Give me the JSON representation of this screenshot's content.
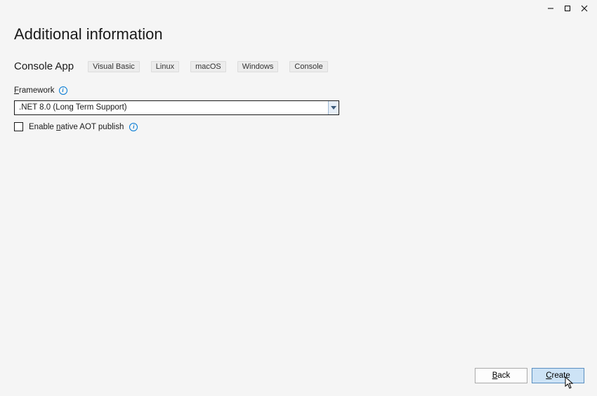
{
  "titlebar": {
    "minimize": "minimize",
    "maximize": "maximize",
    "close": "close"
  },
  "heading": "Additional information",
  "subhead": "Console App",
  "tags": [
    "Visual Basic",
    "Linux",
    "macOS",
    "Windows",
    "Console"
  ],
  "framework": {
    "label_pre": "F",
    "label_post": "ramework",
    "value": ".NET 8.0 (Long Term Support)"
  },
  "aot": {
    "label_pre": "Enable ",
    "label_accel": "n",
    "label_post": "ative AOT publish"
  },
  "buttons": {
    "back_accel": "B",
    "back_rest": "ack",
    "create_accel": "C",
    "create_rest": "reate"
  }
}
